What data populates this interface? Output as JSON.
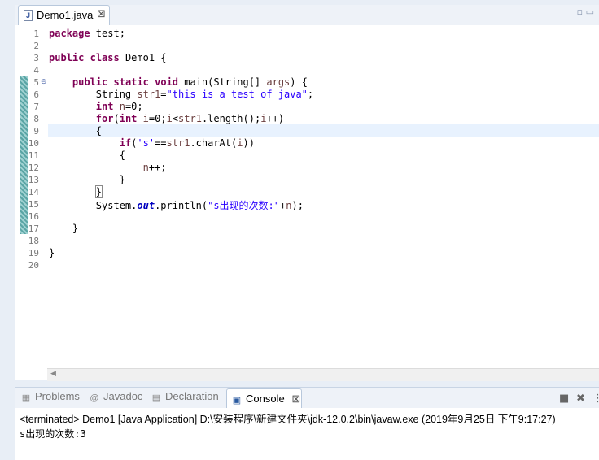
{
  "editor": {
    "tab_label": "Demo1.java",
    "tab_close": "⊠",
    "file_icon": "J",
    "window_controls": "▫ ▭"
  },
  "code_lines": [
    {
      "n": "1",
      "html": "<span class=\"kw\">package</span> test;"
    },
    {
      "n": "2",
      "html": ""
    },
    {
      "n": "3",
      "html": "<span class=\"kw\">public</span> <span class=\"kw\">class</span> Demo1 {"
    },
    {
      "n": "4",
      "html": ""
    },
    {
      "n": "5",
      "html": "    <span class=\"kw\">public</span> <span class=\"kw\">static</span> <span class=\"kw\">void</span> main(String[] <span class=\"var\">args</span>) {"
    },
    {
      "n": "6",
      "html": "        String <span class=\"var\">str1</span>=<span class=\"str\">\"this is a test of java\"</span>;"
    },
    {
      "n": "7",
      "html": "        <span class=\"kw\">int</span> <span class=\"var\">n</span>=0;"
    },
    {
      "n": "8",
      "html": "        <span class=\"kw\">for</span>(<span class=\"kw\">int</span> <span class=\"var\">i</span>=0;<span class=\"var\">i</span>&lt;<span class=\"var\">str1</span>.length();<span class=\"var\">i</span>++)"
    },
    {
      "n": "9",
      "html": "        {"
    },
    {
      "n": "10",
      "html": "            <span class=\"kw\">if</span>(<span class=\"str\">'s'</span>==<span class=\"var\">str1</span>.charAt(<span class=\"var\">i</span>))"
    },
    {
      "n": "11",
      "html": "            {"
    },
    {
      "n": "12",
      "html": "                <span class=\"var\">n</span>++;"
    },
    {
      "n": "13",
      "html": "            }"
    },
    {
      "n": "14",
      "html": "        <span class=\"bracket\">}</span>"
    },
    {
      "n": "15",
      "html": "        System.<span class=\"fld\">out</span>.println(<span class=\"str\">\"s出现的次数:\"</span>+<span class=\"var\">n</span>);"
    },
    {
      "n": "16",
      "html": ""
    },
    {
      "n": "17",
      "html": "    }"
    },
    {
      "n": "18",
      "html": ""
    },
    {
      "n": "19",
      "html": "}"
    },
    {
      "n": "20",
      "html": ""
    }
  ],
  "panel": {
    "tabs": [
      {
        "label": "Problems",
        "icon": "problems-icon",
        "glyph": "▦"
      },
      {
        "label": "Javadoc",
        "icon": "javadoc-icon",
        "glyph": "@"
      },
      {
        "label": "Declaration",
        "icon": "declaration-icon",
        "glyph": "▤"
      }
    ],
    "active_tab": {
      "label": "Console",
      "icon": "console-icon",
      "glyph": "▣",
      "close": "⊠"
    },
    "status": "<terminated> Demo1 [Java Application] D:\\安装程序\\新建文件夹\\jdk-12.0.2\\bin\\javaw.exe (2019年9月25日 下午9:17:27)",
    "output": "s出现的次数:3",
    "tools": {
      "stop": "■",
      "remove": "✖",
      "more": "⋮"
    }
  }
}
